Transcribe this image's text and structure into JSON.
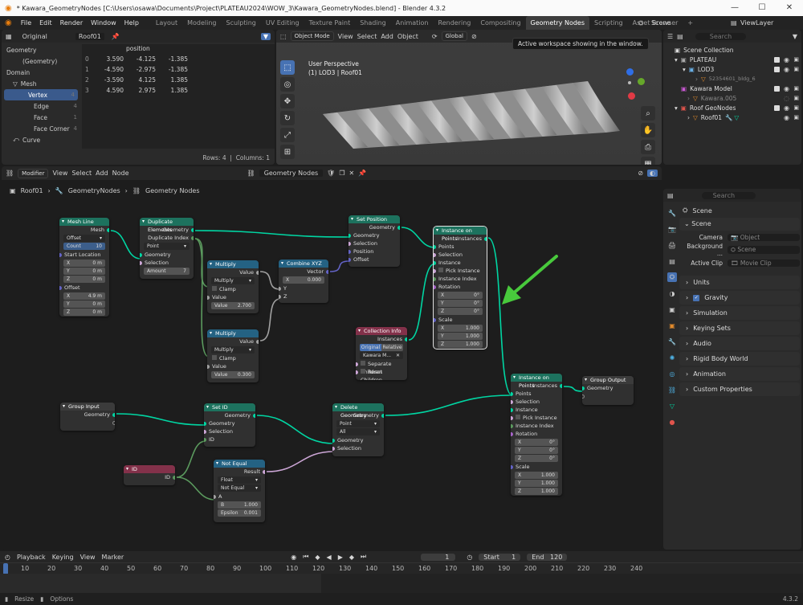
{
  "window": {
    "title": "* Kawara_GeometryNodes [C:\\Users\\osawa\\Documents\\Project\\PLATEAU2024\\WOW_3\\Kawara_GeometryNodes.blend] - Blender 4.3.2",
    "minimize": "—",
    "maximize": "☐",
    "close": "✕"
  },
  "menu": [
    "File",
    "Edit",
    "Render",
    "Window",
    "Help"
  ],
  "workspaces": [
    "Layout",
    "Modeling",
    "Sculpting",
    "UV Editing",
    "Texture Paint",
    "Shading",
    "Animation",
    "Rendering",
    "Compositing",
    "Geometry Nodes",
    "Scripting",
    "Asset Browser",
    "+"
  ],
  "active_workspace": "Geometry Nodes",
  "scene_label": "Scene",
  "viewlayer_label": "ViewLayer",
  "tooltip": "Active workspace showing in the window.",
  "spreadsheet": {
    "mode": "Original",
    "object": "Roof01",
    "side": [
      {
        "label": "Geometry",
        "count": ""
      },
      {
        "label": "(Geometry)",
        "count": ""
      },
      {
        "label": "Domain",
        "count": ""
      },
      {
        "label": "Mesh",
        "count": ""
      },
      {
        "label": "Vertex",
        "count": "4"
      },
      {
        "label": "Edge",
        "count": "4"
      },
      {
        "label": "Face",
        "count": "1"
      },
      {
        "label": "Face Corner",
        "count": "4"
      },
      {
        "label": "Curve",
        "count": ""
      }
    ],
    "column": "position",
    "rows": [
      [
        "0",
        "3.590",
        "-4.125",
        "-1.385"
      ],
      [
        "1",
        "-4.590",
        "-2.975",
        "-1.385"
      ],
      [
        "2",
        "-3.590",
        "4.125",
        "1.385"
      ],
      [
        "3",
        "4.590",
        "2.975",
        "1.385"
      ]
    ],
    "footer_rows": "Rows: 4",
    "footer_cols": "Columns: 1"
  },
  "viewport": {
    "mode": "Object Mode",
    "menus": [
      "View",
      "Select",
      "Add",
      "Object"
    ],
    "orientation": "Global",
    "overlay_title": "User Perspective",
    "overlay_sub": "(1) LOD3 | Roof01"
  },
  "outliner": {
    "search_placeholder": "Search",
    "items": [
      {
        "label": "Scene Collection",
        "indent": 0
      },
      {
        "label": "PLATEAU",
        "indent": 1
      },
      {
        "label": "LOD3",
        "indent": 2
      },
      {
        "label": "52354601_bldg_6",
        "indent": 3
      },
      {
        "label": "Kawara Model",
        "indent": 1
      },
      {
        "label": "Kawara.005",
        "indent": 2
      },
      {
        "label": "Roof GeoNodes",
        "indent": 1
      },
      {
        "label": "Roof01",
        "indent": 2
      }
    ]
  },
  "node_editor": {
    "editor_label": "Modifier",
    "menus": [
      "View",
      "Select",
      "Add",
      "Node"
    ],
    "tree": "Geometry Nodes",
    "breadcrumb": [
      "Roof01",
      "GeometryNodes",
      "Geometry Nodes"
    ]
  },
  "nodes": {
    "mesh_line": {
      "title": "Mesh Line",
      "out": "Mesh",
      "mode": "Offset",
      "count_l": "Count",
      "count_v": "10",
      "start": "Start Location",
      "x": "0 m",
      "y": "0 m",
      "z": "0 m",
      "offset": "Offset",
      "ox": "4.9 m",
      "oy": "0 m",
      "oz": "0 m"
    },
    "dup": {
      "title": "Duplicate Elements",
      "o1": "Geometry",
      "o2": "Duplicate Index",
      "domain": "Point",
      "i1": "Geometry",
      "i2": "Selection",
      "amount_l": "Amount",
      "amount_v": "7"
    },
    "mul1": {
      "title": "Multiply",
      "out": "Value",
      "op": "Multiply",
      "clamp": "Clamp",
      "in1": "Value",
      "v_l": "Value",
      "v_v": "2.700"
    },
    "mul2": {
      "title": "Multiply",
      "out": "Value",
      "op": "Multiply",
      "clamp": "Clamp",
      "in1": "Value",
      "v_l": "Value",
      "v_v": "0.300"
    },
    "combine": {
      "title": "Combine XYZ",
      "out": "Vector",
      "x_l": "X",
      "x_v": "0.000",
      "y": "Y",
      "z": "Z"
    },
    "setpos": {
      "title": "Set Position",
      "out": "Geometry",
      "i1": "Geometry",
      "i2": "Selection",
      "i3": "Position",
      "i4": "Offset"
    },
    "iop1": {
      "title": "Instance on Points",
      "out": "Instances",
      "points": "Points",
      "selection": "Selection",
      "instance": "Instance",
      "pick": "Pick Instance",
      "idx": "Instance Index",
      "rot": "Rotation",
      "rx": "0°",
      "ry": "0°",
      "rz": "0°",
      "scale": "Scale",
      "sx": "1.000",
      "sy": "1.000",
      "sz": "1.000"
    },
    "coll": {
      "title": "Collection Info",
      "out": "Instances",
      "orig": "Original",
      "rel": "Relative",
      "coll": "Kawara M...",
      "sep": "Separate Children",
      "reset": "Reset Children"
    },
    "group_in": {
      "title": "Group Input",
      "out": "Geometry"
    },
    "setid": {
      "title": "Set ID",
      "out": "Geometry",
      "i1": "Geometry",
      "i2": "Selection",
      "i3": "ID"
    },
    "delgeo": {
      "title": "Delete Geometry",
      "out": "Geometry",
      "domain": "Point",
      "mode": "All",
      "i1": "Geometry",
      "i2": "Selection"
    },
    "id": {
      "title": "ID",
      "out": "ID"
    },
    "noteq": {
      "title": "Not Equal",
      "out": "Result",
      "type": "Float",
      "op": "Not Equal",
      "a": "A",
      "b_l": "B",
      "b_v": "1.000",
      "eps_l": "Epsilon",
      "eps_v": "0.001"
    },
    "iop2": {
      "title": "Instance on Points",
      "out": "Instances",
      "points": "Points",
      "selection": "Selection",
      "instance": "Instance",
      "pick": "Pick Instance",
      "idx": "Instance Index",
      "rot": "Rotation",
      "rx": "0°",
      "ry": "0°",
      "rz": "0°",
      "scale": "Scale",
      "sx": "1.000",
      "sy": "1.000",
      "sz": "1.000"
    },
    "group_out": {
      "title": "Group Output",
      "in": "Geometry"
    }
  },
  "properties": {
    "search_placeholder": "Search",
    "title": "Scene",
    "section": "Scene",
    "camera_l": "Camera",
    "camera_v": "Object",
    "bg_l": "Background ...",
    "bg_v": "Scene",
    "clip_l": "Active Clip",
    "clip_v": "Movie Clip",
    "panels": [
      "Units",
      "Gravity",
      "Simulation",
      "Keying Sets",
      "Audio",
      "Rigid Body World",
      "Animation",
      "Custom Properties"
    ]
  },
  "timeline": {
    "menus": [
      "Playback",
      "Keying",
      "View",
      "Marker"
    ],
    "frame": "1",
    "start_l": "Start",
    "start_v": "1",
    "end_l": "End",
    "end_v": "120",
    "ticks": [
      "10",
      "20",
      "30",
      "40",
      "50",
      "60",
      "70",
      "80",
      "90",
      "100",
      "110",
      "120",
      "130",
      "140",
      "150",
      "160",
      "170",
      "180",
      "190",
      "200",
      "210",
      "220",
      "230",
      "240"
    ]
  },
  "status": {
    "left1": "Resize",
    "left2": "Options",
    "version": "4.3.2"
  },
  "colors": {
    "accent": "#4772b3",
    "geo_socket": "#00d6a3",
    "arrow": "#48c93c"
  }
}
